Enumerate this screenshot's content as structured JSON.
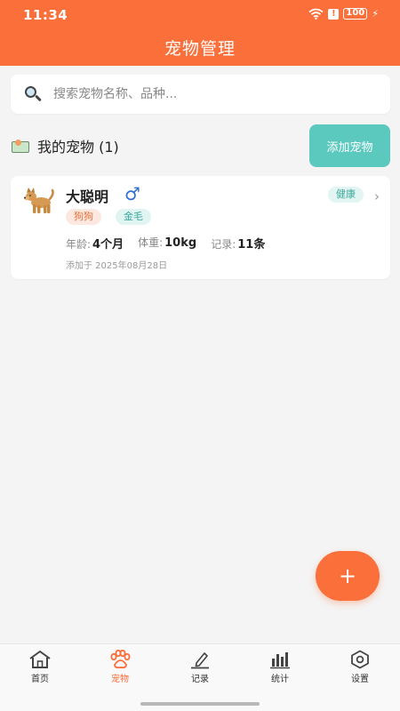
{
  "status_bar": {
    "time": "11:34",
    "battery": "100"
  },
  "header": {
    "title": "宠物管理"
  },
  "search": {
    "placeholder": "搜索宠物名称、品种..."
  },
  "section": {
    "title": "我的宠物 (1)",
    "add_button_label": "添加宠物"
  },
  "pets": [
    {
      "name": "大聪明",
      "gender_symbol": "♂",
      "species": "狗狗",
      "breed": "金毛",
      "health_status": "健康",
      "age_label": "年龄:",
      "age_value": "4个月",
      "weight_label": "体重:",
      "weight_value": "10kg",
      "records_label": "记录:",
      "records_value": "11条",
      "added_text": "添加于 2025年08月28日"
    }
  ],
  "fab": {
    "label": "+"
  },
  "bottom_nav": [
    {
      "label": "首页",
      "icon": "home-icon"
    },
    {
      "label": "宠物",
      "icon": "paw-icon",
      "active": true
    },
    {
      "label": "记录",
      "icon": "pencil-icon"
    },
    {
      "label": "统计",
      "icon": "bar-chart-icon"
    },
    {
      "label": "设置",
      "icon": "gear-icon"
    }
  ],
  "colors": {
    "accent": "#fb6f3a",
    "teal": "#5cc9bf",
    "background": "#f4f4f4"
  }
}
